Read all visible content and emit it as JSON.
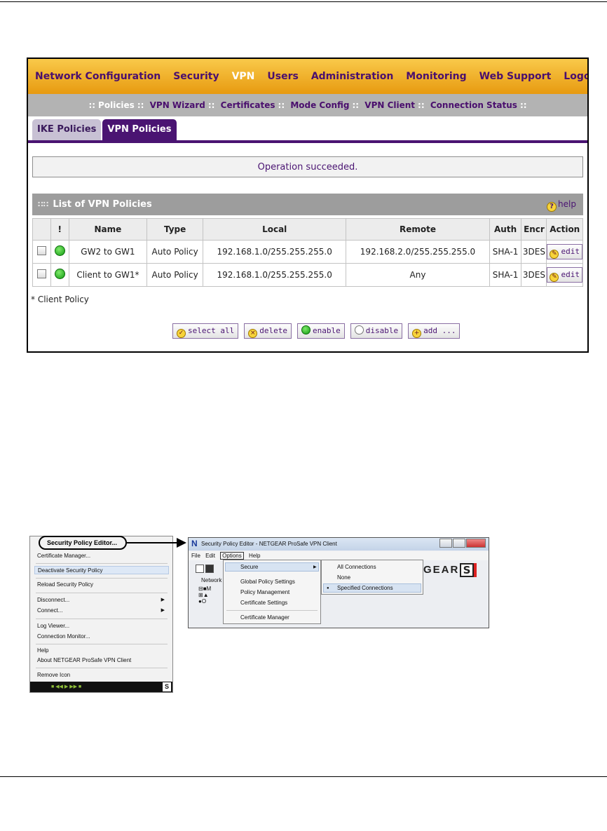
{
  "main_nav": [
    "Network Configuration",
    "Security",
    "VPN",
    "Users",
    "Administration",
    "Monitoring",
    "Web Support",
    "Logout"
  ],
  "sub_nav": [
    "Policies",
    "VPN Wizard",
    "Certificates",
    "Mode Config",
    "VPN Client",
    "Connection Status"
  ],
  "tabs": [
    "IKE Policies",
    "VPN Policies"
  ],
  "message": "Operation succeeded.",
  "list_title": "List of VPN Policies",
  "help_label": "help",
  "columns": [
    "!",
    "Name",
    "Type",
    "Local",
    "Remote",
    "Auth",
    "Encr",
    "Action"
  ],
  "rows": [
    {
      "name": "GW2 to GW1",
      "type": "Auto Policy",
      "local": "192.168.1.0/255.255.255.0",
      "remote": "192.168.2.0/255.255.255.0",
      "auth": "SHA-1",
      "encr": "3DES",
      "action": "edit"
    },
    {
      "name": "Client to GW1*",
      "type": "Auto Policy",
      "local": "192.168.1.0/255.255.255.0",
      "remote": "Any",
      "auth": "SHA-1",
      "encr": "3DES",
      "action": "edit"
    }
  ],
  "footnote": "* Client Policy",
  "buttons": {
    "select_all": "select all",
    "delete": "delete",
    "enable": "enable",
    "disable": "disable",
    "add": "add ..."
  },
  "context_menu": {
    "callout": "Security Policy Editor...",
    "items": [
      "Certificate Manager...",
      "Deactivate Security Policy",
      "Reload Security Policy",
      "Disconnect...",
      "Connect...",
      "Log Viewer...",
      "Connection Monitor...",
      "Help",
      "About NETGEAR ProSafe VPN Client",
      "Remove Icon"
    ]
  },
  "editor": {
    "title": "Security Policy Editor - NETGEAR ProSafe VPN Client",
    "menubar": [
      "File",
      "Edit",
      "Options",
      "Help"
    ],
    "tree_label": "Network",
    "options_menu": [
      "Secure",
      "Global Policy Settings",
      "Policy Management",
      "Certificate Settings",
      "Certificate Manager"
    ],
    "secure_submenu": [
      "All Connections",
      "None",
      "Specified Connections"
    ],
    "brand": "GEAR"
  }
}
